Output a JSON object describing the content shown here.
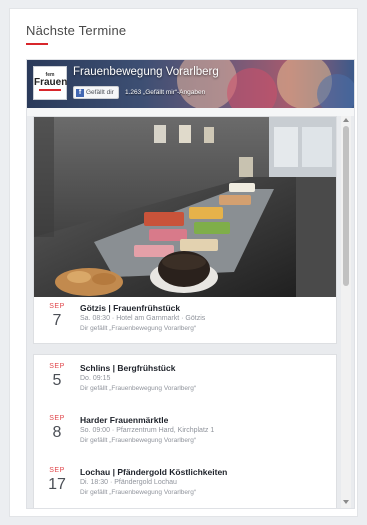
{
  "section": {
    "heading": "Nächste Termine"
  },
  "page": {
    "name": "Frauenbewegung Vorarlberg",
    "logo_small": "fem",
    "logo_big": "Frauen",
    "like_button": "Gefällt dir",
    "like_count": "1.263 „Gefällt mir“-Angaben"
  },
  "events": [
    {
      "month": "SEP",
      "day": "7",
      "title": "Götzis | Frauenfrühstück",
      "when_where": "Sa. 08:30 · Hotel am Garnmarkt · Götzis",
      "liked": "Dir gefällt „Frauenbewegung Vorarlberg“"
    },
    {
      "month": "SEP",
      "day": "5",
      "title": "Schlins | Bergfrühstück",
      "when_where": "Do. 09:15",
      "liked": "Dir gefällt „Frauenbewegung Vorarlberg“"
    },
    {
      "month": "SEP",
      "day": "8",
      "title": "Harder Frauenmärktle",
      "when_where": "So. 09:00 · Pfarrzentrum Hard, Kirchplatz 1",
      "liked": "Dir gefällt „Frauenbewegung Vorarlberg“"
    },
    {
      "month": "SEP",
      "day": "17",
      "title": "Lochau | Pfändergold Köstlichkeiten",
      "when_where": "Di. 18:30 · Pfändergold Lochau",
      "liked": "Dir gefällt „Frauenbewegung Vorarlberg“"
    }
  ],
  "colors": {
    "accent": "#d8262b",
    "date_month": "#e0454a",
    "facebook": "#4267b2"
  }
}
